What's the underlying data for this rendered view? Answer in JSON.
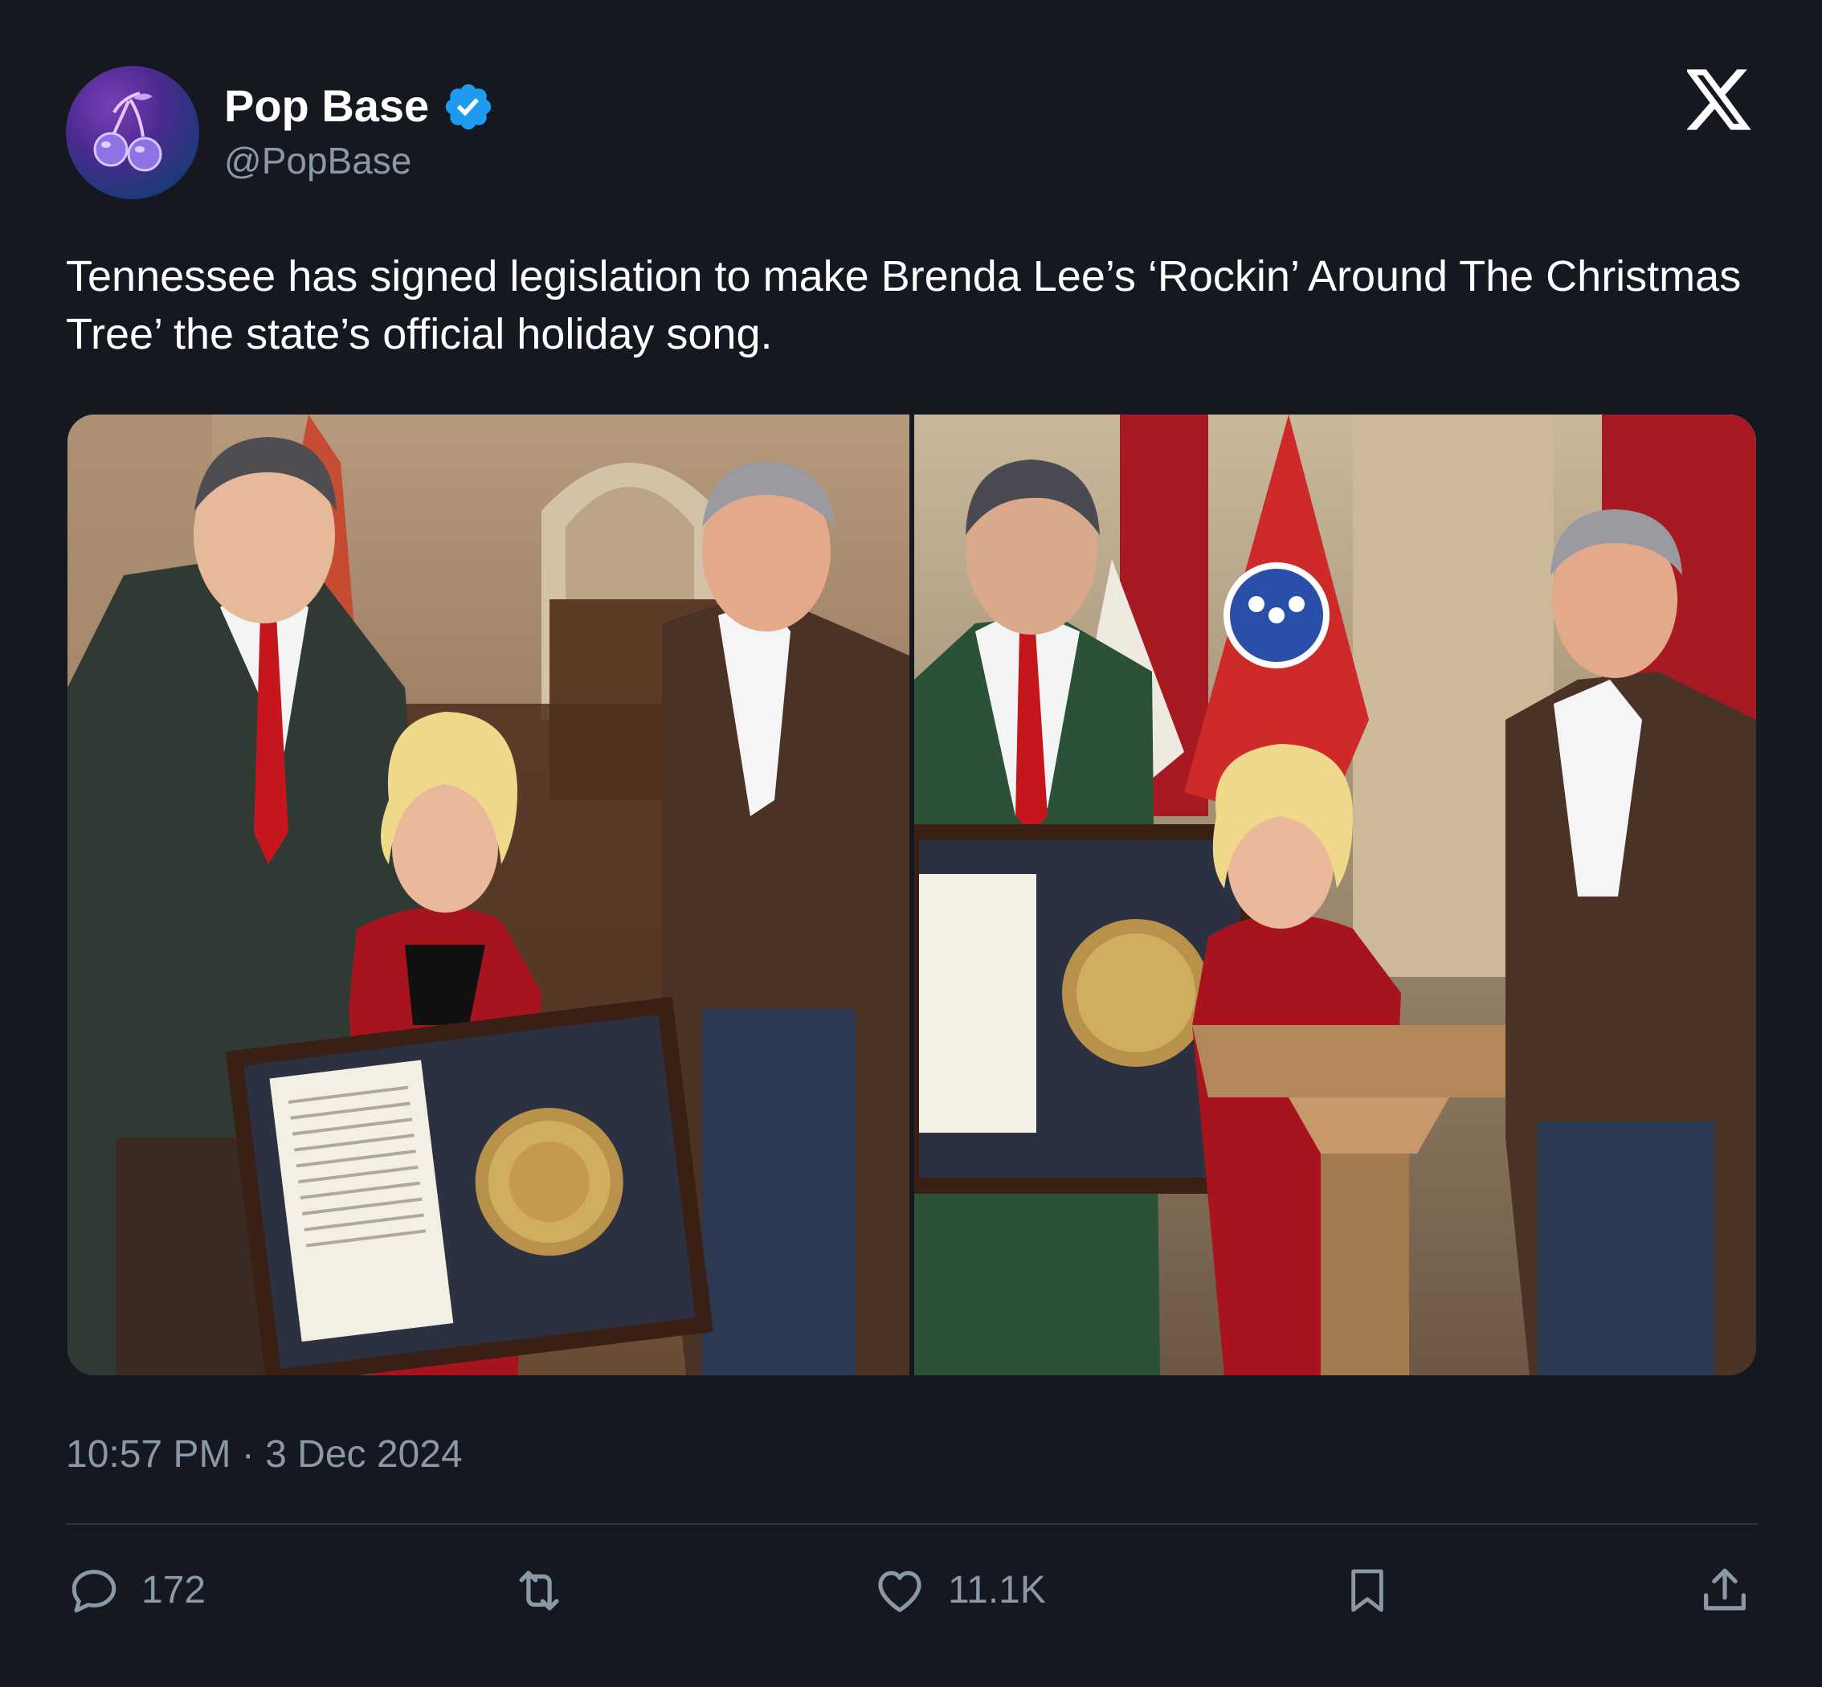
{
  "author": {
    "display_name": "Pop Base",
    "handle": "@PopBase",
    "verified": true,
    "avatar_icon": "cherries-icon"
  },
  "platform_logo": "x-logo",
  "tweet": {
    "text": "Tennessee has signed legislation to make Brenda Lee’s ‘Rockin’ Around The Christmas Tree’ the state’s official holiday song.",
    "media_description_icons": [
      "photo-left",
      "photo-right"
    ]
  },
  "meta": {
    "time": "10:57 PM",
    "separator": "·",
    "date": "3 Dec 2024"
  },
  "actions": {
    "replies": {
      "icon": "reply-icon",
      "count": "172"
    },
    "retweets": {
      "icon": "retweet-icon",
      "count": ""
    },
    "likes": {
      "icon": "heart-icon",
      "count": "11.1K"
    },
    "bookmark": {
      "icon": "bookmark-icon"
    },
    "share": {
      "icon": "share-icon"
    }
  },
  "colors": {
    "background": "#151821",
    "text": "#ffffff",
    "secondary_text": "#8b98a5",
    "verified_blue": "#1d9bf0",
    "divider": "#2f3336"
  }
}
